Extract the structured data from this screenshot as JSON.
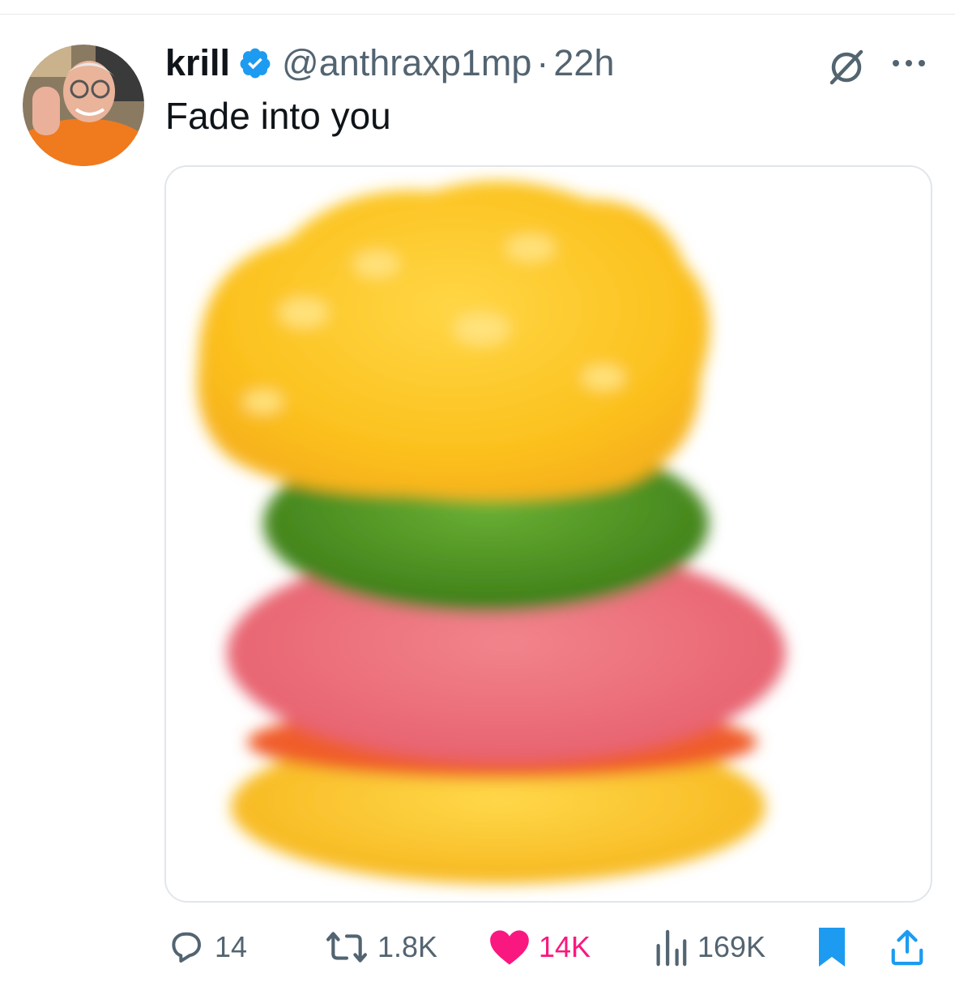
{
  "post": {
    "author": {
      "display_name": "krill",
      "handle": "@anthraxp1mp",
      "verified": true,
      "avatar": "avatar-photo"
    },
    "separator": "·",
    "time_ago": "22h",
    "text": "Fade into you",
    "media": {
      "kind": "image",
      "subject": "gummy-burger"
    }
  },
  "icons": {
    "verified": "verified-badge-icon",
    "grok": "grok-icon",
    "more": "more-options-icon",
    "reply": "reply-icon",
    "repost": "repost-icon",
    "like": "like-icon",
    "views": "views-icon",
    "bookmark": "bookmark-icon",
    "share": "share-icon"
  },
  "actions": {
    "replies": "14",
    "reposts": "1.8K",
    "likes": "14K",
    "views": "169K",
    "liked": true,
    "bookmarked": true
  },
  "colors": {
    "text": "#0f1419",
    "secondary": "#536471",
    "accent": "#1d9bf0",
    "like": "#f91880"
  }
}
